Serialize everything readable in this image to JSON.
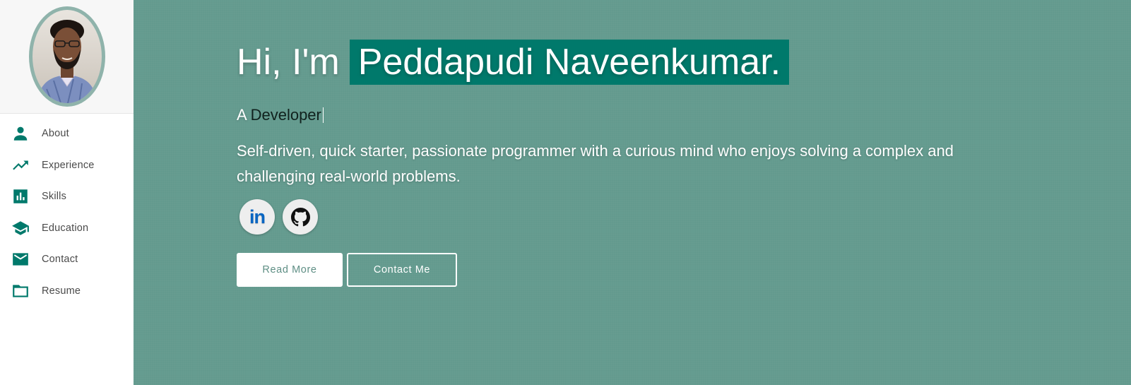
{
  "sidebar": {
    "items": [
      {
        "label": "About",
        "icon": "person-icon"
      },
      {
        "label": "Experience",
        "icon": "trending-up-icon"
      },
      {
        "label": "Skills",
        "icon": "bar-chart-icon"
      },
      {
        "label": "Education",
        "icon": "graduation-cap-icon"
      },
      {
        "label": "Contact",
        "icon": "mail-icon"
      },
      {
        "label": "Resume",
        "icon": "folder-icon"
      }
    ]
  },
  "hero": {
    "greeting": "Hi, I'm",
    "name": "Peddapudi Naveenkumar.",
    "typed_prefix": "A",
    "typed_word": "Developer",
    "bio": "Self-driven, quick starter, passionate programmer with a curious mind who enjoys solving a complex and challenging real-world problems.",
    "socials": [
      {
        "label": "in",
        "icon": "linkedin-icon"
      },
      {
        "icon": "github-icon"
      }
    ],
    "buttons": {
      "read_more": "Read More",
      "contact_me": "Contact Me"
    }
  },
  "colors": {
    "accent": "#00796b",
    "hero_background": "#639a8e",
    "sidebar_background": "#ffffff"
  }
}
